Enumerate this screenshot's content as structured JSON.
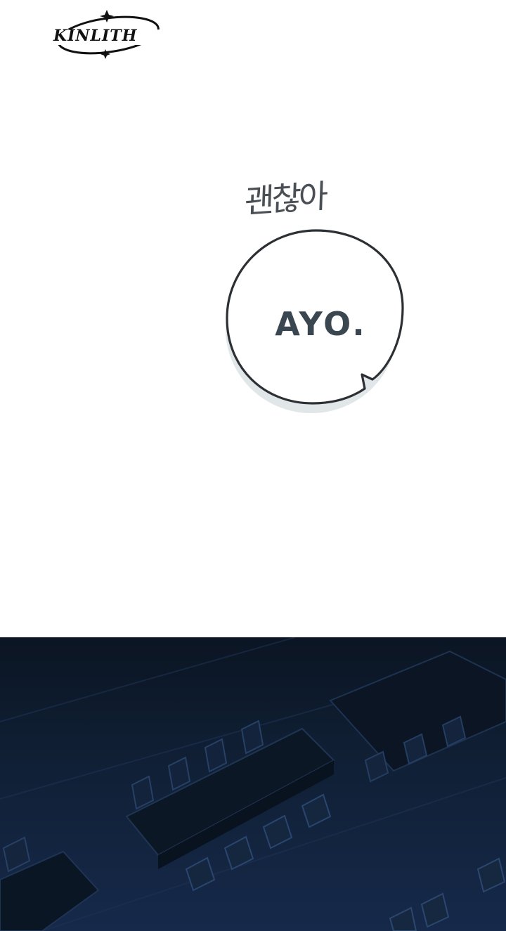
{
  "logo": {
    "text": "KINLITH",
    "icon": "orbit-star-icon"
  },
  "sfx": {
    "text": "괜찮아"
  },
  "speech_bubble": {
    "text": "AYO."
  },
  "scene": {
    "description_icon": "classroom-desks-illustration",
    "colors": {
      "top": "#0b1523",
      "bottom": "#16294a"
    }
  }
}
